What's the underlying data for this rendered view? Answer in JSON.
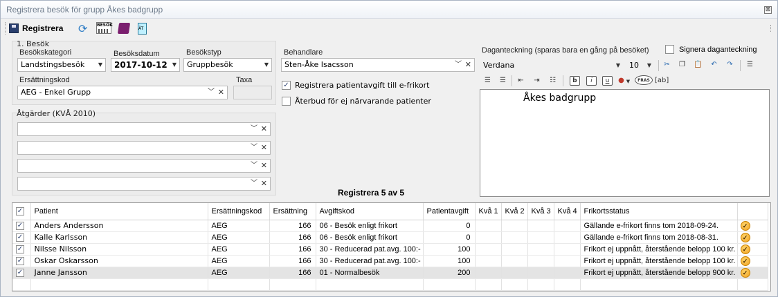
{
  "window": {
    "title": "Registrera besök för grupp Åkes badgrupp",
    "close_glyph": "⊠"
  },
  "toolbar": {
    "save_label": "Registrera",
    "besok_label": "BESÖK",
    "doc_label": "ÄT"
  },
  "section1": {
    "legend": "1. Besök",
    "category_label": "Besökskategori",
    "category_value": "Landstingsbesök",
    "date_label": "Besöksdatum",
    "date_value": "2017-10-12",
    "type_label": "Besökstyp",
    "type_value": "Gruppbesök",
    "code_label": "Ersättningskod",
    "code_value": "AEG - Enkel Grupp",
    "taxa_label": "Taxa",
    "taxa_value": ""
  },
  "actions": {
    "legend": "Åtgärder (KVÅ 2010)",
    "rows": [
      "",
      "",
      "",
      ""
    ]
  },
  "practitioner": {
    "label": "Behandlare",
    "value": "Sten-Åke Isacsson",
    "check1_label": "Registrera patientavgift till e-frikort",
    "check1_checked": true,
    "check2_label": "Återbud för ej närvarande patienter",
    "check2_checked": false
  },
  "register_count": "Registrera 5 av 5",
  "note": {
    "label": "Daganteckning (sparas bara en gång på besöket)",
    "sign_label": "Signera daganteckning",
    "font_name": "Verdana",
    "font_size": "10",
    "text": "Åkes badgrupp",
    "fras_label": "FRAS",
    "ab_label": "[ab]"
  },
  "grid": {
    "columns": [
      "Patient",
      "Ersättningskod",
      "Ersättning",
      "Avgiftskod",
      "Patientavgift",
      "Kvå 1",
      "Kvå 2",
      "Kvå 3",
      "Kvå 4",
      "Frikortsstatus"
    ],
    "rows": [
      {
        "patient": "Anders Andersson",
        "code": "AEG",
        "amount": "166",
        "fee_code": "06 - Besök enligt frikort",
        "fee": "0",
        "status": "Gällande e-frikort finns tom 2018-09-24."
      },
      {
        "patient": "Kalle Karlsson",
        "code": "AEG",
        "amount": "166",
        "fee_code": "06 - Besök enligt frikort",
        "fee": "0",
        "status": "Gällande e-frikort finns tom 2018-08-31."
      },
      {
        "patient": "Nilsse Nilsson",
        "code": "AEG",
        "amount": "166",
        "fee_code": "30 - Reducerad pat.avg. 100:-",
        "fee": "100",
        "status": "Frikort ej uppnått, återstående belopp 100 kr."
      },
      {
        "patient": "Oskar Oskarsson",
        "code": "AEG",
        "amount": "166",
        "fee_code": "30 - Reducerad pat.avg. 100:-",
        "fee": "100",
        "status": "Frikort ej uppnått, återstående belopp 100 kr."
      },
      {
        "patient": "Janne Jansson",
        "code": "AEG",
        "amount": "166",
        "fee_code": "01 - Normalbesök",
        "fee": "200",
        "status": "Frikort ej uppnått, återstående belopp 900 kr."
      }
    ]
  }
}
